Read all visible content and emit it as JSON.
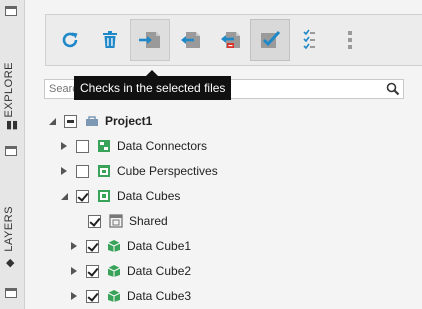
{
  "left_strip": {
    "explore_label": "EXPLORE",
    "layers_label": "LAYERS"
  },
  "toolbar": {
    "buttons": [
      {
        "name": "refresh",
        "icon": "refresh-icon"
      },
      {
        "name": "delete",
        "icon": "trash-icon"
      },
      {
        "name": "check-in",
        "icon": "check-in-icon"
      },
      {
        "name": "check-out",
        "icon": "check-out-icon"
      },
      {
        "name": "undo-check-out",
        "icon": "undo-check-out-icon"
      },
      {
        "name": "select-all",
        "icon": "checkbox-checked-icon"
      },
      {
        "name": "checklist",
        "icon": "checklist-icon"
      },
      {
        "name": "more",
        "icon": "vertical-dots-icon"
      }
    ],
    "tooltip": "Checks in the selected files"
  },
  "search": {
    "placeholder": "Search",
    "value": ""
  },
  "tree": {
    "items": [
      {
        "label": "Project1",
        "state": "partial",
        "expander": "expanded",
        "icon": "project-icon",
        "bold": true
      },
      {
        "label": "Data Connectors",
        "state": "unchecked",
        "expander": "collapsed",
        "icon": "data-connectors-icon"
      },
      {
        "label": "Cube Perspectives",
        "state": "unchecked",
        "expander": "collapsed",
        "icon": "cube-perspectives-icon"
      },
      {
        "label": "Data Cubes",
        "state": "checked",
        "expander": "expanded",
        "icon": "data-cubes-icon"
      },
      {
        "label": "Shared",
        "state": "checked",
        "expander": "none",
        "icon": "shared-icon"
      },
      {
        "label": "Data Cube1",
        "state": "checked",
        "expander": "collapsed",
        "icon": "data-cube-icon"
      },
      {
        "label": "Data Cube2",
        "state": "checked",
        "expander": "collapsed",
        "icon": "data-cube-icon"
      },
      {
        "label": "Data Cube3",
        "state": "checked",
        "expander": "collapsed",
        "icon": "data-cube-icon"
      }
    ]
  },
  "colors": {
    "accent_blue": "#1e88c8",
    "accent_green": "#3aa35a",
    "accent_red": "#d9342b"
  }
}
